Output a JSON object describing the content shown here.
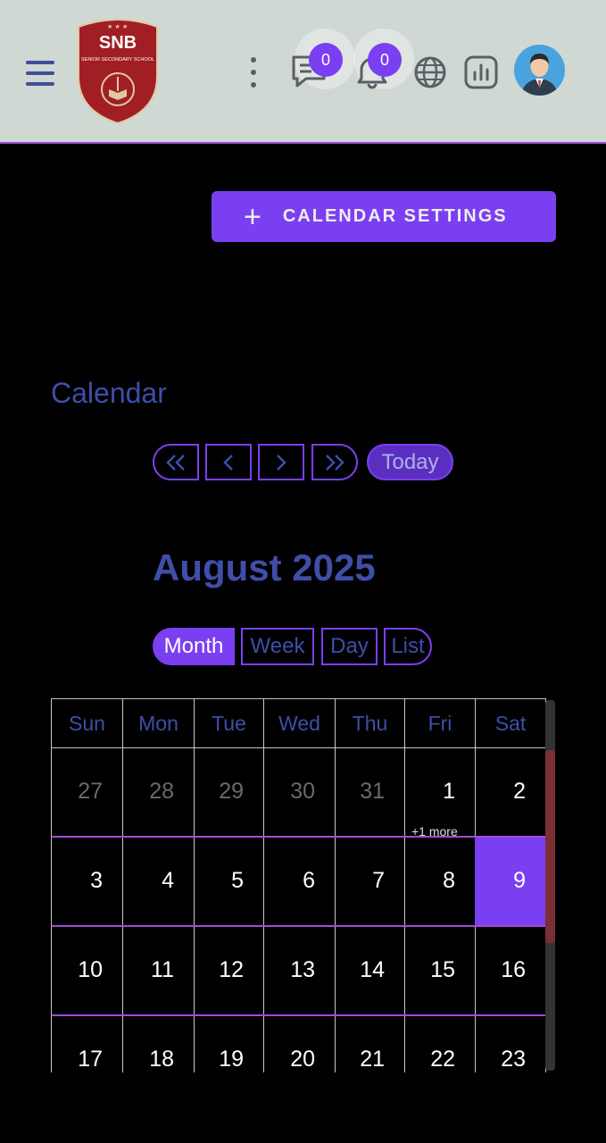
{
  "header": {
    "logo": {
      "name": "SNB",
      "subtitle": "SENIOR SECONDARY SCHOOL"
    },
    "messages_count": "0",
    "notifications_count": "0"
  },
  "toolbar": {
    "settings_label": "CALENDAR SETTINGS"
  },
  "calendar": {
    "heading": "Calendar",
    "today_label": "Today",
    "month_title": "August 2025",
    "views": [
      "Month",
      "Week",
      "Day",
      "List"
    ],
    "active_view": "Month",
    "weekdays": [
      "Sun",
      "Mon",
      "Tue",
      "Wed",
      "Thu",
      "Fri",
      "Sat"
    ],
    "weeks": [
      [
        "27",
        "28",
        "29",
        "30",
        "31",
        "1",
        "2"
      ],
      [
        "3",
        "4",
        "5",
        "6",
        "7",
        "8",
        "9"
      ],
      [
        "10",
        "11",
        "12",
        "13",
        "14",
        "15",
        "16"
      ],
      [
        "17",
        "18",
        "19",
        "20",
        "21",
        "22",
        "23"
      ]
    ],
    "more_label": "+1 more",
    "today_day": "9"
  },
  "colors": {
    "accent": "#7b3ff2",
    "header_bg": "#cfd8d3",
    "text_blue": "#3f4ea8",
    "divider": "#a24bd6"
  }
}
